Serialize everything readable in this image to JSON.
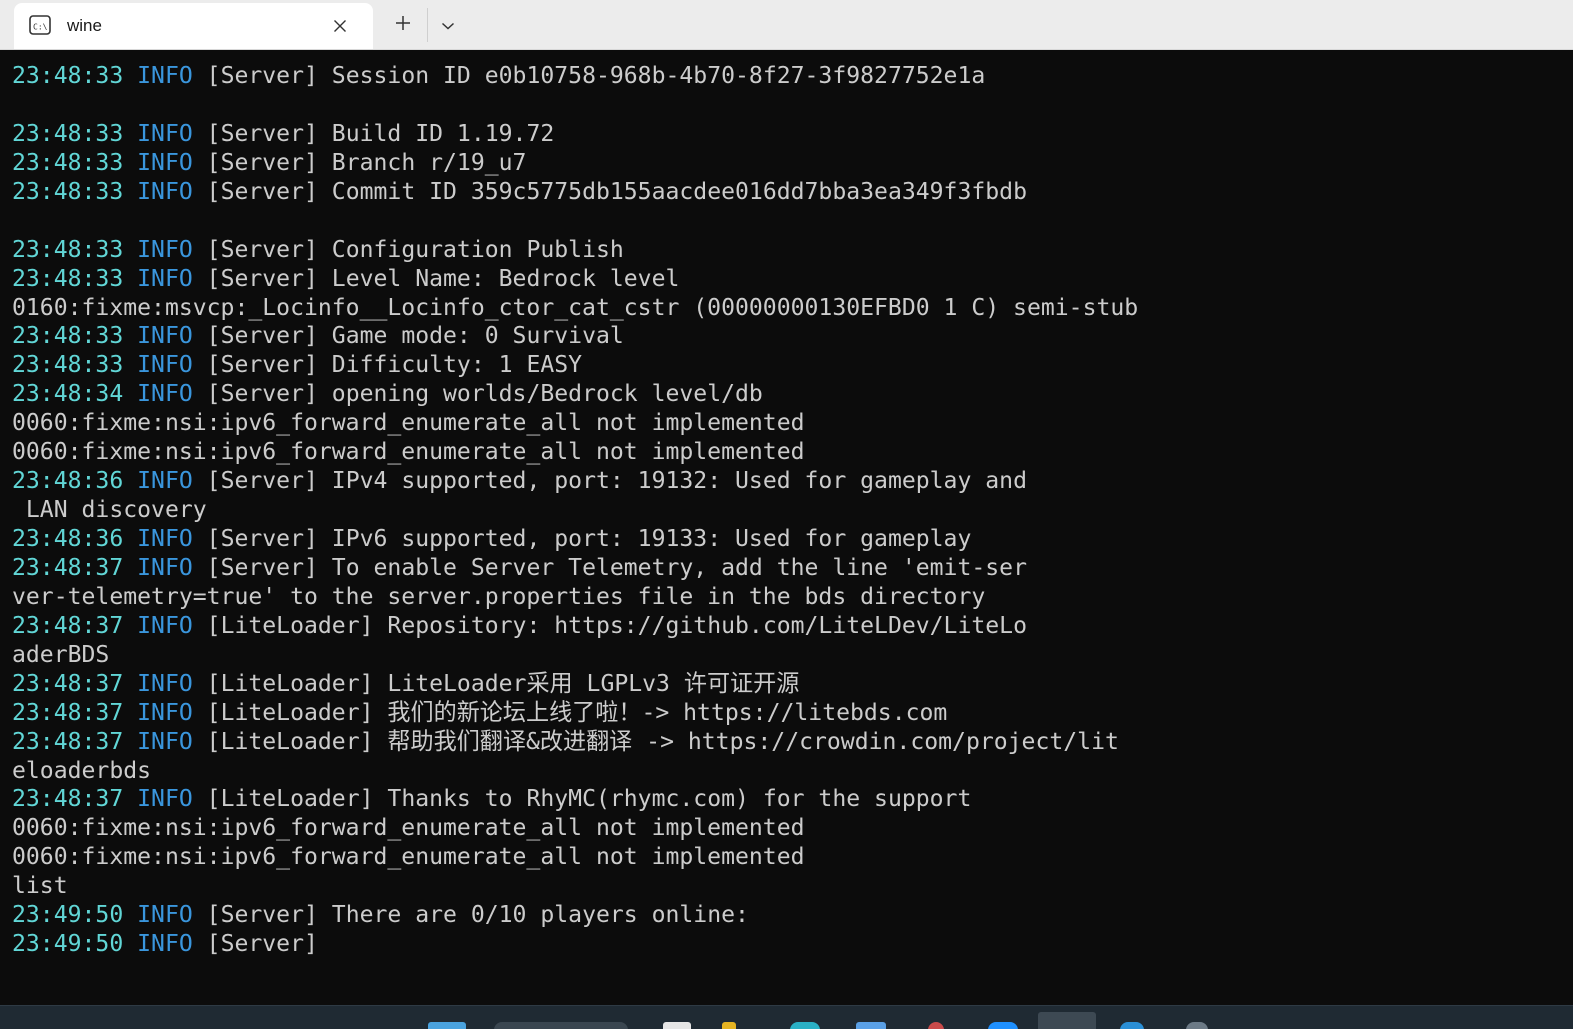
{
  "window": {
    "tab_title": "wine",
    "tab_icon": "terminal-icon",
    "close_icon": "close-icon",
    "new_tab_icon": "plus-icon",
    "dropdown_icon": "chevron-down-icon"
  },
  "colors": {
    "background": "#0c0c0c",
    "text": "#cccccc",
    "timestamp": "#61d6d6",
    "level": "#3a96dd",
    "titlebar": "#ececec"
  },
  "lines": [
    {
      "ts": "23:48:33",
      "lv": "INFO",
      "msg": " [Server] Session ID e0b10758-968b-4b70-8f27-3f9827752e1a"
    },
    {
      "text": ""
    },
    {
      "ts": "23:48:33",
      "lv": "INFO",
      "msg": " [Server] Build ID 1.19.72"
    },
    {
      "ts": "23:48:33",
      "lv": "INFO",
      "msg": " [Server] Branch r/19_u7"
    },
    {
      "ts": "23:48:33",
      "lv": "INFO",
      "msg": " [Server] Commit ID 359c5775db155aacdee016dd7bba3ea349f3fbdb"
    },
    {
      "text": ""
    },
    {
      "ts": "23:48:33",
      "lv": "INFO",
      "msg": " [Server] Configuration Publish"
    },
    {
      "ts": "23:48:33",
      "lv": "INFO",
      "msg": " [Server] Level Name: Bedrock level"
    },
    {
      "text": "0160:fixme:msvcp:_Locinfo__Locinfo_ctor_cat_cstr (00000000130EFBD0 1 C) semi-stub"
    },
    {
      "ts": "23:48:33",
      "lv": "INFO",
      "msg": " [Server] Game mode: 0 Survival"
    },
    {
      "ts": "23:48:33",
      "lv": "INFO",
      "msg": " [Server] Difficulty: 1 EASY"
    },
    {
      "ts": "23:48:34",
      "lv": "INFO",
      "msg": " [Server] opening worlds/Bedrock level/db"
    },
    {
      "text": "0060:fixme:nsi:ipv6_forward_enumerate_all not implemented"
    },
    {
      "text": "0060:fixme:nsi:ipv6_forward_enumerate_all not implemented"
    },
    {
      "ts": "23:48:36",
      "lv": "INFO",
      "msg": " [Server] IPv4 supported, port: 19132: Used for gameplay and"
    },
    {
      "text": " LAN discovery"
    },
    {
      "ts": "23:48:36",
      "lv": "INFO",
      "msg": " [Server] IPv6 supported, port: 19133: Used for gameplay"
    },
    {
      "ts": "23:48:37",
      "lv": "INFO",
      "msg": " [Server] To enable Server Telemetry, add the line 'emit-ser"
    },
    {
      "text": "ver-telemetry=true' to the server.properties file in the bds directory"
    },
    {
      "ts": "23:48:37",
      "lv": "INFO",
      "msg": " [LiteLoader] Repository: https://github.com/LiteLDev/LiteLo"
    },
    {
      "text": "aderBDS"
    },
    {
      "ts": "23:48:37",
      "lv": "INFO",
      "msg": " [LiteLoader] LiteLoader采用 LGPLv3 许可证开源"
    },
    {
      "ts": "23:48:37",
      "lv": "INFO",
      "msg": " [LiteLoader] 我们的新论坛上线了啦！-> https://litebds.com"
    },
    {
      "ts": "23:48:37",
      "lv": "INFO",
      "msg": " [LiteLoader] 帮助我们翻译&改进翻译 -> https://crowdin.com/project/lit"
    },
    {
      "text": "eloaderbds"
    },
    {
      "ts": "23:48:37",
      "lv": "INFO",
      "msg": " [LiteLoader] Thanks to RhyMC(rhymc.com) for the support"
    },
    {
      "text": "0060:fixme:nsi:ipv6_forward_enumerate_all not implemented"
    },
    {
      "text": "0060:fixme:nsi:ipv6_forward_enumerate_all not implemented"
    },
    {
      "text": "list"
    },
    {
      "ts": "23:49:50",
      "lv": "INFO",
      "msg": " [Server] There are 0/10 players online:"
    },
    {
      "ts": "23:49:50",
      "lv": "INFO",
      "msg": " [Server]"
    }
  ]
}
